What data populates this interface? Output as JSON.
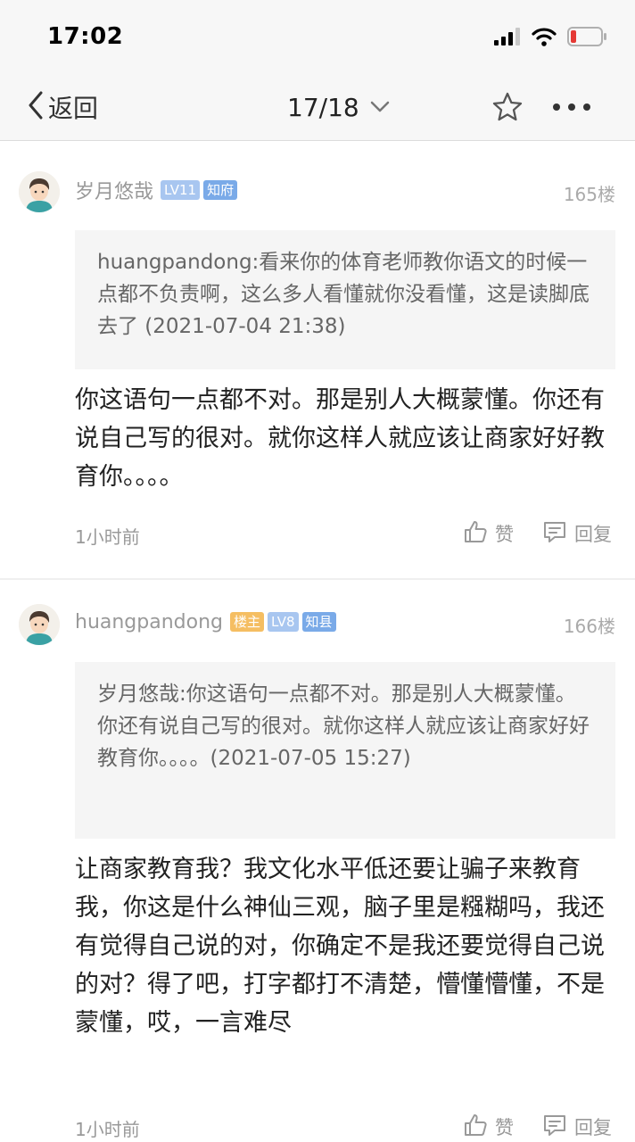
{
  "status_bar": {
    "time": "17:02",
    "signal_icon": "cellular-signal-icon",
    "wifi_icon": "wifi-icon",
    "battery_icon": "battery-low-icon",
    "battery_color": "#e53935"
  },
  "nav": {
    "back_label": "返回",
    "page_label": "17/18",
    "page_icon": "chevron-down-icon",
    "favorite_icon": "star-icon",
    "more_icon": "more-dots-icon"
  },
  "posts": [
    {
      "author": "岁月悠哉",
      "badges": [
        "LV11",
        "知府"
      ],
      "floor": "165楼",
      "quote": "huangpandong:看来你的体育老师教你语文的时候一点都不负责啊，这么多人看懂就你没看懂，这是读脚底去了 (2021-07-04 21:38)",
      "body": "你这语句一点都不对。那是别人大概蒙懂。你还有说自己写的很对。就你这样人就应该让商家好好教育你。。。。",
      "time": "1小时前",
      "like_label": "赞",
      "reply_label": "回复"
    },
    {
      "author": "huangpandong",
      "badges": [
        "楼主",
        "LV8",
        "知县"
      ],
      "floor": "166楼",
      "quote": "岁月悠哉:你这语句一点都不对。那是别人大概蒙懂。你还有说自己写的很对。就你这样人就应该让商家好好教育你。。。。(2021-07-05 15:27)",
      "body": "让商家教育我？我文化水平低还要让骗子来教育我，你这是什么神仙三观，脑子里是糨糊吗，我还有觉得自己说的对，你确定不是我还要觉得自己说的对？得了吧，打字都打不清楚，懵懂懵懂，不是蒙懂，哎，一言难尽",
      "time": "1小时前",
      "like_label": "赞",
      "reply_label": "回复"
    }
  ],
  "colors": {
    "nav_background": "#f7f7f7",
    "quote_background": "#f5f5f5",
    "badge_level": "#a8c6f0",
    "badge_rank": "#7aaae8",
    "badge_op": "#f5be62",
    "meta_text": "#999999"
  }
}
